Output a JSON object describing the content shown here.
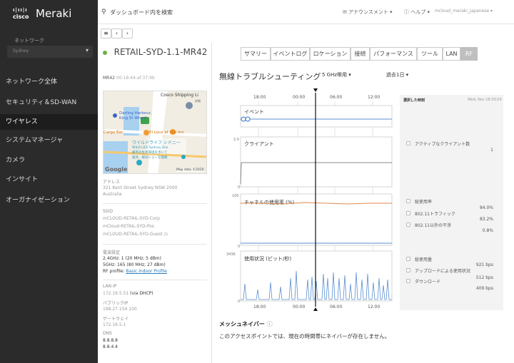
{
  "brand": {
    "cisco": "cisco",
    "meraki": "Meraki"
  },
  "sidebar": {
    "network_label": "ネットワーク",
    "network_value": "Sydney",
    "items": [
      {
        "label": "ネットワーク全体"
      },
      {
        "label": "セキュリティ＆SD-WAN"
      },
      {
        "label": "ワイヤレス"
      },
      {
        "label": "システムマネージャ"
      },
      {
        "label": "カメラ"
      },
      {
        "label": "インサイト"
      },
      {
        "label": "オーガナイゼーション"
      }
    ]
  },
  "topbar": {
    "search_placeholder": "ダッシュボード内を検索",
    "announcements": "アナウンスメント ▾",
    "help": "ヘルプ ▾",
    "user": "mcloud_meraki_japanese ▾"
  },
  "device": {
    "name": "RETAIL-SYD-1.1-MR42",
    "model": "MR42",
    "mac": "00:18:44:af:37:9b",
    "address_label": "アドレス",
    "address": "321 Kent Street Sydney NSW 2000 Australia",
    "ssid_label": "SSID",
    "ssids": [
      "mCLOUD-RETAIL-SYD-Corp",
      "mCloud-RETAIL-SYD-Pos",
      "mCLOUD-RETAIL-SYD-Guest"
    ],
    "radio_label": "電波設定",
    "radio_24": "2.4GHz: 1 (20 MHz; 5 dBm)",
    "radio_5": "5GHz: 165 (80 MHz; 27 dBm)",
    "rf_profile_prefix": "RF profile: ",
    "rf_profile": "Basic Indoor Profile",
    "lanip_label": "LAN IP",
    "lanip": "172.16.5.51",
    "lanip_suffix": " (via DHCP)",
    "public_label": "パブリックIP",
    "public_ip": "198.27.154.100",
    "gw_label": "ゲートウェイ",
    "gateway": "172.16.5.1",
    "dns_label": "DNS",
    "dns1": "8.8.8.8",
    "dns2": "8.8.4.4"
  },
  "map": {
    "labels": [
      "Cosco Shipping Li",
      "Darling Harbour,",
      "King St Wharf",
      "Cargo Bar",
      "El Loco at Slip Inn",
      "ワイルドライフ シドニー",
      "WILD LIFE Sydney Zoo",
      "都市の生息環境を歩いて",
      "発見、毎日ショーを開催",
      "Google",
      "Map data ©2020",
      "詳細"
    ]
  },
  "tabs": [
    "サマリー",
    "イベントログ",
    "ロケーション",
    "接続",
    "パフォーマンス",
    "ツール",
    "LAN",
    "RF"
  ],
  "rf": {
    "title": "無線トラブルシューティング",
    "band": "5 GHz帯用 ▾",
    "range": "過去1日 ▾"
  },
  "chart_data": {
    "type": "line",
    "x_ticks": [
      "18:00",
      "00:00",
      "06:00",
      "12:00"
    ],
    "panels": [
      {
        "name": "イベント",
        "y_max": ""
      },
      {
        "name": "クライアント",
        "y_max": "2.0",
        "y_min": "0"
      },
      {
        "name": "チャネルの使用率 (%)",
        "y_max": "100",
        "y_min": "0"
      },
      {
        "name": "使用状況 (ビット/秒)",
        "y_max": "343K",
        "y_min": "0"
      }
    ],
    "colors": {
      "line": "#5a8fd0",
      "channel": "#e08a4a",
      "grid": "#e3e3e3"
    }
  },
  "right_panel": {
    "selected_time": "選択した時刻",
    "date": "Wed, Nov 18 03:03",
    "active_clients": "アクティブなクライアント数",
    "active_clients_val": "1",
    "util_total": "総使用率",
    "util_total_val": "84.0%",
    "wifi_traffic": "802.11トラフィック",
    "wifi_traffic_val": "83.2%",
    "non_wifi": "802.11以外の干渉",
    "non_wifi_val": "0.8%",
    "usage_total": "総使用量",
    "usage_total_val": "921 bps",
    "upload": "アップロードによる使用状況",
    "upload_val": "512 bps",
    "download": "ダウンロード",
    "download_val": "409 bps"
  },
  "mesh": {
    "title": "メッシュネイバー",
    "text": "このアクセスポイントでは、現在の時間帯にネイバーが存在しません。"
  }
}
